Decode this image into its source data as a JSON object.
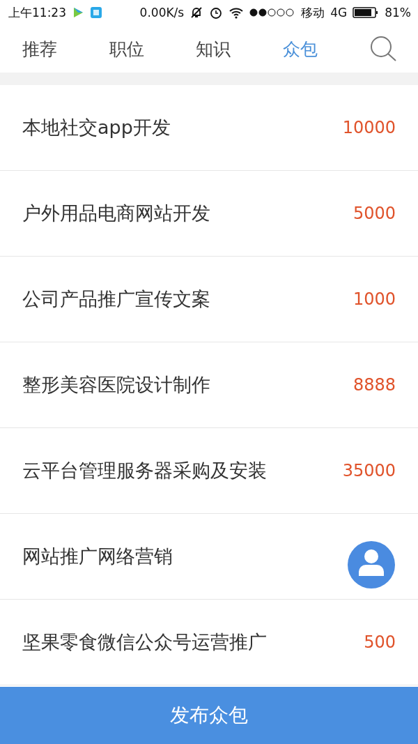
{
  "status_bar": {
    "time": "上午11:23",
    "speed": "0.00K/s",
    "carrier": "移动",
    "network": "4G",
    "battery": "81%"
  },
  "tabs": [
    {
      "label": "推荐",
      "selected": false
    },
    {
      "label": "职位",
      "selected": false
    },
    {
      "label": "知识",
      "selected": false
    },
    {
      "label": "众包",
      "selected": true
    }
  ],
  "projects": [
    {
      "title": "本地社交app开发",
      "price": "10000"
    },
    {
      "title": "户外用品电商网站开发",
      "price": "5000"
    },
    {
      "title": "公司产品推广宣传文案",
      "price": "1000"
    },
    {
      "title": "整形美容医院设计制作",
      "price": "8888"
    },
    {
      "title": "云平台管理服务器采购及安装",
      "price": "35000"
    },
    {
      "title": "网站推广网络营销"
    },
    {
      "title": "坚果零食微信公众号运营推广",
      "price": "500"
    }
  ],
  "publish_button": "发布众包"
}
